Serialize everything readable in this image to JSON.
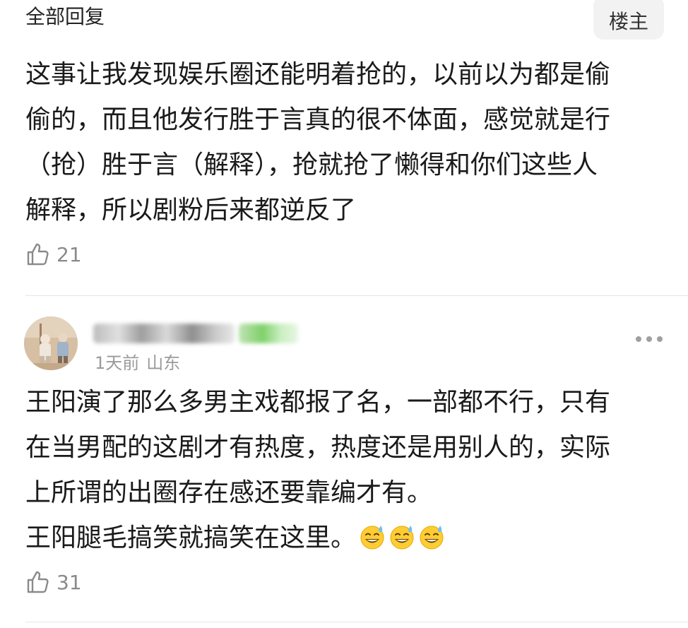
{
  "header": {
    "section_label": "全部回复",
    "op_badge": "楼主"
  },
  "comments": [
    {
      "lines": [
        "这事让我发现娱乐圈还能明着抢的，以前以为都是偷",
        "偷的，而且他发行胜于言真的很不体面，感觉就是行",
        "（抢）胜于言（解释），抢就抢了懒得和你们这些人",
        "解释，所以剧粉后来都逆反了"
      ],
      "likes": "21",
      "like_icon": "thumbs-up-icon"
    },
    {
      "time": "1天前",
      "location": "山东",
      "lines": [
        "王阳演了那么多男主戏都报了名，一部都不行，只有",
        "在当男配的这剧才有热度，热度还是用别人的，实际",
        "上所谓的出圈存在感还要靠编才有。",
        "王阳腿毛搞笑就搞笑在这里。"
      ],
      "emoji": [
        "sweat-smile-emoji",
        "sweat-smile-emoji",
        "sweat-smile-emoji"
      ],
      "likes": "31",
      "like_icon": "thumbs-up-icon"
    }
  ],
  "colors": {
    "text": "#1a1a1a",
    "muted": "#9a9a9a",
    "badge_bg": "#f2f2f2",
    "divider": "#e6e6e6"
  }
}
